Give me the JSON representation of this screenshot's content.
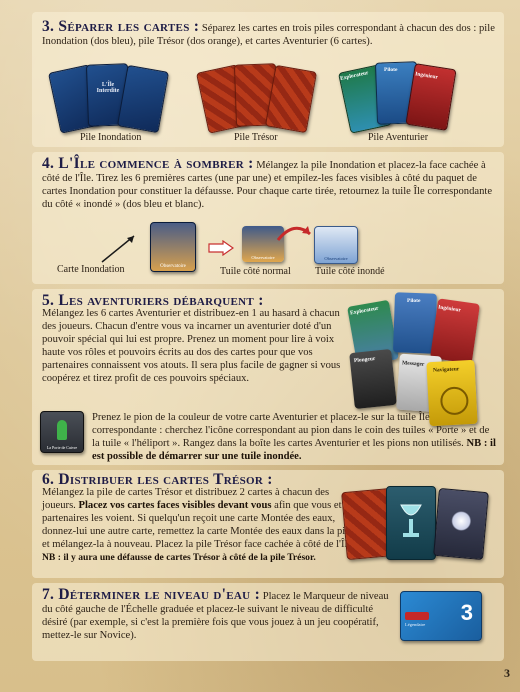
{
  "sections": {
    "s3": {
      "title": "3. Séparer les cartes :",
      "text": "Séparez les cartes en trois piles correspondant à chacun des dos : pile Inondation (dos bleu), pile Trésor (dos orange), et cartes Aventurier (6 cartes).",
      "pile_inondation": "Pile Inondation",
      "pile_tresor": "Pile Trésor",
      "pile_aventurier": "Pile Aventurier"
    },
    "s4": {
      "title": "4. L'Île commence à sombrer :",
      "text": "Mélangez la pile Inondation et placez-la face cachée à côté de l'Île. Tirez les 6 premières cartes (une par une) et empilez-les faces visibles à côté du paquet de cartes Inondation pour constituer la défausse. Pour chaque carte tirée, retournez la tuile Île correspondante du côté « inondé » (dos bleu et blanc).",
      "carte_inondation": "Carte Inondation",
      "tuile_normal": "Tuile côté normal",
      "tuile_inonde": "Tuile côté inondé"
    },
    "s5": {
      "title": "5. Les aventuriers débarquent :",
      "text": "Mélangez les 6 cartes Aventurier et distribuez-en 1 au hasard à chacun des joueurs. Chacun d'entre vous va incarner un aventurier doté d'un pouvoir spécial qui lui est propre. Prenez un moment pour lire à voix haute vos rôles et pouvoirs écrits au dos des cartes pour que vos partenaires connaissent vos atouts. Il sera plus facile de gagner si vous coopérez et tirez profit de ces pouvoirs spéciaux.",
      "text2_plain": "Prenez le pion de la couleur de votre carte Aventurier et placez-le sur la tuile Île correspondante : cherchez l'icône correspondant au pion dans le coin des tuiles « Porte » et de la tuile « l'héliport ». Rangez dans la boîte les cartes Aventurier et les pions non utilisés. ",
      "text2_bold": "NB : il est possible de démarrer sur une tuile inondée."
    },
    "s6": {
      "title": "6. Distribuer les cartes Trésor :",
      "text_a": "Mélangez la pile de cartes Trésor et distribuez 2 cartes à chacun des joueurs. ",
      "text_bold": "Placez vos cartes faces visibles devant vous",
      "text_b": " afin que vous et vos partenaires les voient. Si quelqu'un reçoit une carte Montée des eaux, donnez-lui une autre carte, remettez la carte Montée des eaux dans la pile et mélangez-la à nouveau. Placez la pile Trésor face cachée à côté de l'Île.",
      "nb": "NB : il y aura une défausse de cartes Trésor à côté de la pile Trésor."
    },
    "s7": {
      "title": "7. Déterminer le niveau d'eau :",
      "text": "Placez le Marqueur de niveau du côté gauche de l'Échelle graduée et placez-le suivant le niveau de difficulté désiré (par exemple, si c'est la première fois que vous jouez à un jeu coopératif, mettez-le sur Novice).",
      "level": "3",
      "marker_label": "Légendaire"
    }
  },
  "card_texts": {
    "ile_interdite": "L'Île Interdite",
    "explorateur": "Explorateur",
    "pilote": "Pilote",
    "ingenieur": "Ingénieur",
    "plongeur": "Plongeur",
    "messager": "Messager",
    "navigateur": "Navigateur",
    "tile_name": "Observatoire",
    "pawn_tile": "La Porte de Cuivre"
  },
  "page_number": "3",
  "colors": {
    "title": "#1e1c46",
    "flood_blue": "#1b3f78",
    "treasure_orange": "#b33617"
  }
}
